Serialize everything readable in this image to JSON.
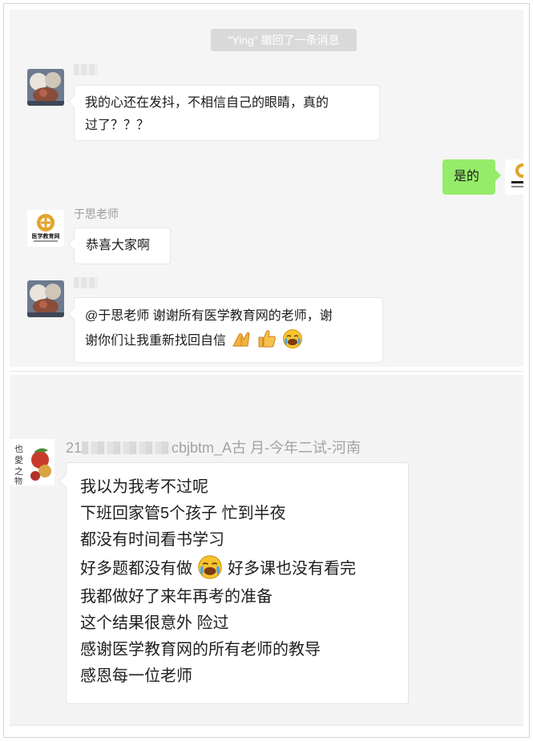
{
  "chat1": {
    "system_notice": "\"Ying\" 撤回了一条消息",
    "messages": [
      {
        "sender": "",
        "lines": [
          "我的心还在发抖，不相信自己的眼睛，真的",
          "过了？？？"
        ]
      },
      {
        "sender": "me",
        "lines": [
          "是的"
        ]
      },
      {
        "sender": "于思老师",
        "lines": [
          "恭喜大家啊"
        ]
      },
      {
        "sender": "",
        "lines": [
          "@于思老师 谢谢所有医学教育网的老师，谢",
          "谢你们让我重新找回自信"
        ]
      }
    ],
    "avatar_logo_text": "医学教育网",
    "emojis": [
      "hands-icon",
      "thumbs-up-icon",
      "crying-laugh-icon"
    ]
  },
  "chat2": {
    "sender_prefix": "21",
    "sender_suffix": "cbjbtm_A古  月-今年二试-河南",
    "lines": [
      "我以为我考不过呢",
      "下班回家管5个孩子  忙到半夜",
      "都没有时间看书学习",
      "好多题都没有做",
      "好多课也没有看完",
      "我都做好了来年再考的准备",
      "这个结果很意外  险过",
      "感谢医学教育网的所有老师的教导",
      "感恩每一位老师"
    ]
  },
  "colors": {
    "chat_background": "#f5f5f5",
    "self_bubble": "#95ec69",
    "other_bubble": "#ffffff",
    "system_notice_bg": "#dadada"
  }
}
